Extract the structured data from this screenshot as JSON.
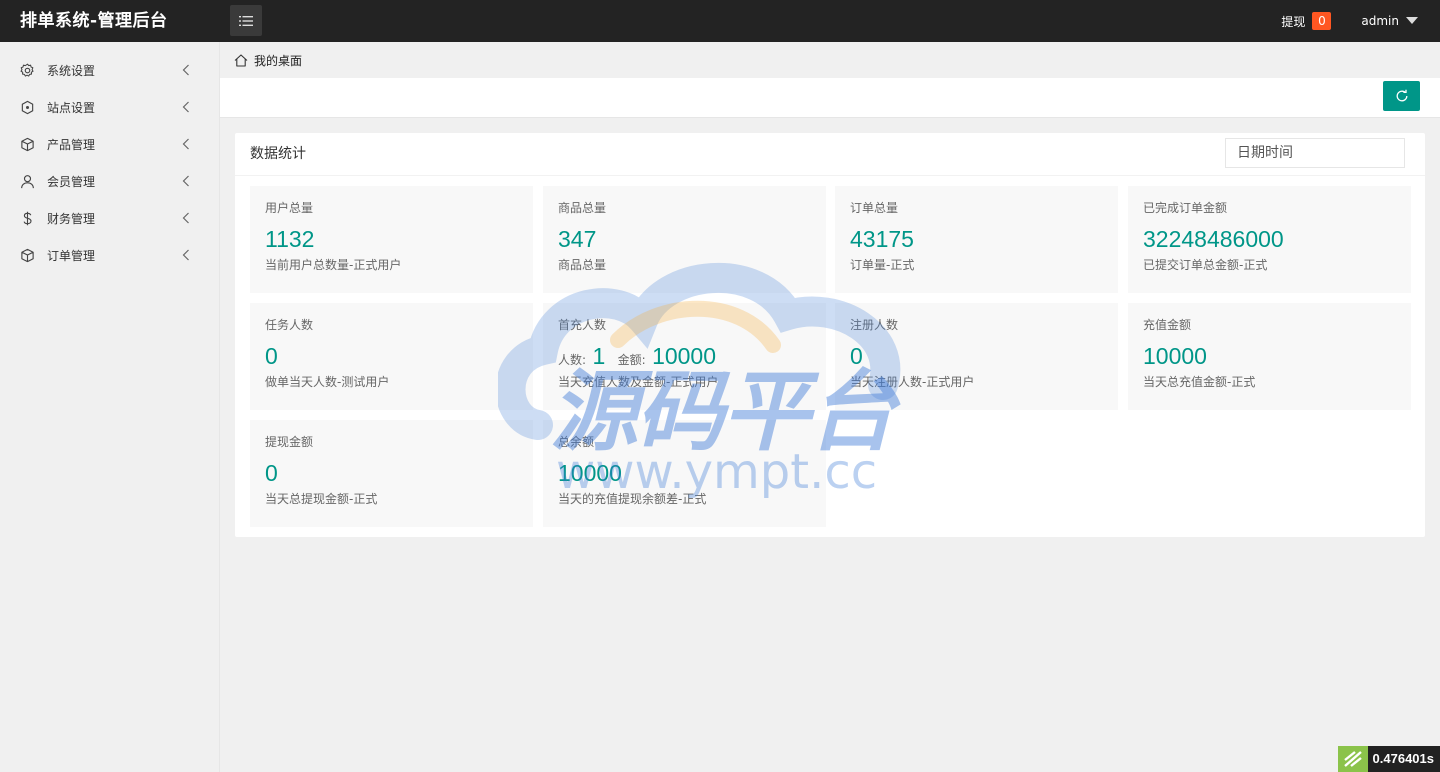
{
  "header": {
    "brand": "排单系统-管理后台",
    "withdraw_label": "提现",
    "withdraw_count": "0",
    "user_name": "admin"
  },
  "sidebar": {
    "items": [
      {
        "label": "系统设置",
        "icon": "gear-icon"
      },
      {
        "label": "站点设置",
        "icon": "site-icon"
      },
      {
        "label": "产品管理",
        "icon": "box-icon"
      },
      {
        "label": "会员管理",
        "icon": "user-icon"
      },
      {
        "label": "财务管理",
        "icon": "dollar-icon"
      },
      {
        "label": "订单管理",
        "icon": "box-icon"
      }
    ]
  },
  "breadcrumb": {
    "home": "我的桌面"
  },
  "stats_card": {
    "title": "数据统计",
    "date_placeholder": "日期时间",
    "items": [
      {
        "label": "用户总量",
        "value": "1132",
        "desc": "当前用户总数量-正式用户"
      },
      {
        "label": "商品总量",
        "value": "347",
        "desc": "商品总量"
      },
      {
        "label": "订单总量",
        "value": "43175",
        "desc": "订单量-正式"
      },
      {
        "label": "已完成订单金额",
        "value": "32248486000",
        "desc": "已提交订单总金额-正式"
      },
      {
        "label": "任务人数",
        "value": "0",
        "desc": "做单当天人数-测试用户"
      },
      {
        "label": "首充人数",
        "people_label": "人数:",
        "people_value": "1",
        "amount_label": "金额:",
        "amount_value": "10000",
        "desc": "当天充值人数及金额-正式用户"
      },
      {
        "label": "注册人数",
        "value": "0",
        "desc": "当天注册人数-正式用户"
      },
      {
        "label": "充值金额",
        "value": "10000",
        "desc": "当天总充值金额-正式"
      },
      {
        "label": "提现金额",
        "value": "0",
        "desc": "当天总提现金额-正式"
      },
      {
        "label": "总余额",
        "value": "10000",
        "desc": "当天的充值提现余额差-正式"
      }
    ]
  },
  "watermark": {
    "title": "源码平台",
    "url": "www.ympt.cc"
  },
  "timer": {
    "value": "0.476401s"
  },
  "colors": {
    "accent": "#009688",
    "badge": "#ff5722",
    "header_bg": "#232323"
  }
}
